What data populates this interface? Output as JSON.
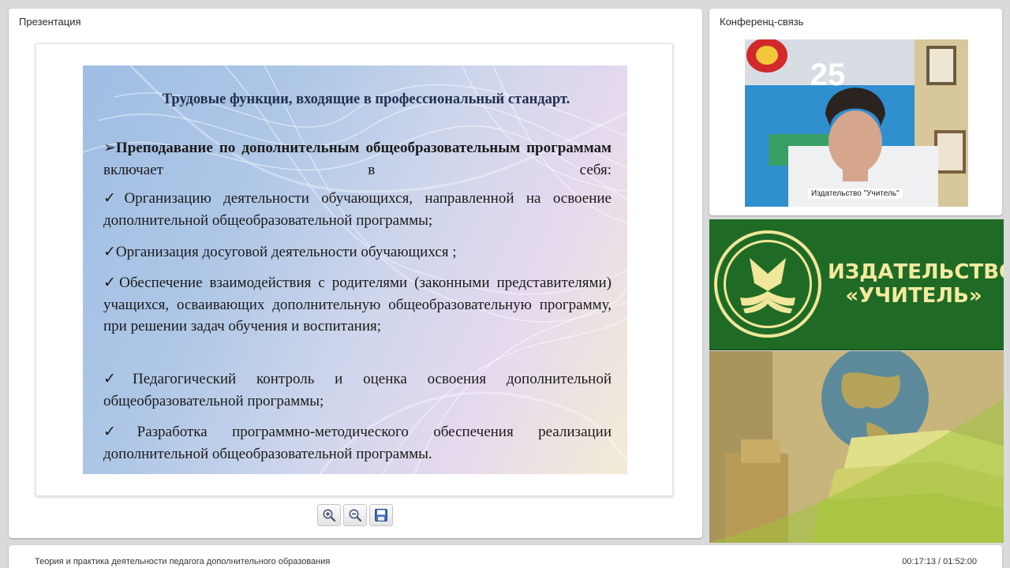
{
  "presentation_panel": {
    "title": "Презентация"
  },
  "conference_panel": {
    "title": "Конференц-связь",
    "video_caption": "Издательство \"Учитель\"",
    "poster_number": "25"
  },
  "slide": {
    "title": "Трудовые функции, входящие в профессиональный стандарт.",
    "intro_bold": "Преподавание по дополнительным общеобразовательным программам",
    "intro_rest": " включает в себя:",
    "items": [
      "Организацию деятельности обучающихся, направленной на освоение дополнительной общеобразовательной программы;",
      "Организация досуговой деятельности обучающихся ;",
      "Обеспечение взаимодействия с родителями (законными представителями) учащихся, осваивающих дополнительную общеобразовательную программу, при решении задач обучения и воспитания;",
      "Педагогический контроль и оценка освоения дополнительной общеобразовательной программы;",
      "Разработка программно-методического обеспечения реализации дополнительной общеобразовательной программы."
    ],
    "arrow_bullet": "➢",
    "check_bullet": "✓"
  },
  "toolbar": {
    "buttons": [
      "zoom-in",
      "zoom-out",
      "save"
    ]
  },
  "banner": {
    "line1": "ИЗДАТЕЛЬСТВО",
    "line2": "«УЧИТЕЛЬ»"
  },
  "bottom_bar": {
    "title": "Теория и практика деятельности педагога дополнительного образования",
    "time": "00:17:13 / 01:52:00"
  },
  "colors": {
    "banner_green": "#1f6b25",
    "banner_text": "#f3eaa0",
    "slide_title": "#1f2f4d"
  }
}
